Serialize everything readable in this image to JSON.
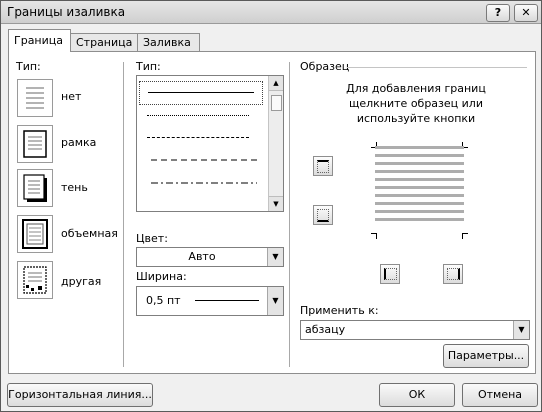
{
  "window": {
    "title": "Границы изаливка",
    "help_label": "?",
    "close_label": "✕"
  },
  "tabs": [
    {
      "label": "Граница"
    },
    {
      "label": "Страница"
    },
    {
      "label": "Заливка"
    }
  ],
  "setting": {
    "label": "Тип:",
    "items": [
      {
        "label": "нет"
      },
      {
        "label": "рамка"
      },
      {
        "label": "тень"
      },
      {
        "label": "объемная"
      },
      {
        "label": "другая"
      }
    ]
  },
  "style": {
    "label": "Тип:",
    "color_label": "Цвет:",
    "color_value": "Авто",
    "width_label": "Ширина:",
    "width_value": "0,5 пт"
  },
  "preview": {
    "label": "Образец",
    "hint_line1": "Для добавления границ",
    "hint_line2": "щелкните образец или",
    "hint_line3": "используйте кнопки",
    "apply_label": "Применить к:",
    "apply_value": "абзацу",
    "options_button": "Параметры..."
  },
  "footer": {
    "horizontal_line_button": "Горизонтальная линия...",
    "ok_button": "ОК",
    "cancel_button": "Отмена"
  }
}
